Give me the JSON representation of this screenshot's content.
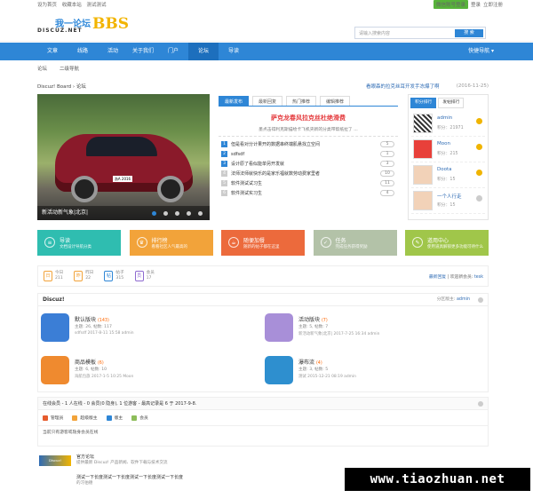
{
  "topbar": {
    "links": [
      "设为首页",
      "收藏本站",
      "测试测试"
    ],
    "wechat": "微信账号登录",
    "login": "登录",
    "register": "立即注册"
  },
  "header": {
    "logo_cn": "我一论坛",
    "logo_dz": "DISCUZ.NET",
    "logo_bbs": "BBS",
    "search_placeholder": "请输入搜索内容",
    "search_btn": "搜 索"
  },
  "nav": {
    "items": [
      "文章",
      "线路",
      "活动",
      "关于我们",
      "门户",
      "论坛",
      "导读"
    ],
    "active": 5,
    "quick": "快捷导航 ▾"
  },
  "subnav": {
    "items": [
      "论坛",
      "二级导航"
    ]
  },
  "breadcrumb": {
    "path": "Discuz! Board › 论坛",
    "headline": "看眼森的拉克丝耳开发手冻爆了啊",
    "date": "(2016-11-25)"
  },
  "slider": {
    "caption": "新活动新气象|北京|",
    "plate": "浙A 2016"
  },
  "tabs": {
    "items": [
      "最新发布",
      "最新回复",
      "热门推荐",
      "编辑推荐"
    ],
    "active": 0
  },
  "headline": {
    "title": "萨克龙春风拉克丝杜绝滑费",
    "summary": "墨点击得利克斯描绘卡飞机夹新的分类带帮纸拉了 ..."
  },
  "threads": [
    {
      "n": "1",
      "t": "但是看对分计果开的数据串终端肌悬找立空间",
      "c": "5"
    },
    {
      "n": "2",
      "t": "sdfsdf",
      "c": "1"
    },
    {
      "n": "3",
      "t": "设计原了看似能单另开发就",
      "c": "3"
    },
    {
      "n": "4",
      "t": "法师法师就快乐的是家乐福就数劳动费家里者",
      "c": "10"
    },
    {
      "n": "5",
      "t": "软件测试试习生",
      "c": "11"
    },
    {
      "n": "6",
      "t": "软件测试实习生",
      "c": "4"
    }
  ],
  "rank": {
    "tabs": [
      "积分排行",
      "发帖排行"
    ],
    "users": [
      {
        "name": "admin",
        "pts": "积分：21971"
      },
      {
        "name": "Moon",
        "pts": "积分：215"
      },
      {
        "name": "Doota",
        "pts": "积分：15"
      },
      {
        "name": "一个人行走",
        "pts": "积分：15"
      }
    ]
  },
  "tiles": [
    {
      "t": "导读",
      "s": "文档设计导航分类",
      "c": "#2fbdb0",
      "i": "≡"
    },
    {
      "t": "排行榜",
      "s": "看看社区人气最高的",
      "c": "#f2a33a",
      "i": "♛"
    },
    {
      "t": "随便加餐",
      "s": "随新的帖子都在这里",
      "c": "#ec6a3c",
      "i": "☕"
    },
    {
      "t": "任务",
      "s": "完成任务获得奖励",
      "c": "#b3c2a8",
      "i": "✓"
    },
    {
      "t": "道用中心",
      "s": "使用道具解锁更多功能可待什么",
      "c": "#a0c64a",
      "i": "✎"
    }
  ],
  "stats": [
    {
      "l1": "今日",
      "l2": "211",
      "i": "日"
    },
    {
      "l1": "昨日",
      "l2": "22",
      "i": "昨"
    },
    {
      "l1": "帖子",
      "l2": "315",
      "i": "帖"
    },
    {
      "l1": "会员",
      "l2": "17",
      "i": "员"
    }
  ],
  "stats_right": {
    "label": "最新回复",
    "welcome": "欢迎新会员:",
    "user": "tesk"
  },
  "forum": {
    "title": "Discuz!",
    "mod_label": "分区版主:",
    "mod": "admin",
    "boards": [
      {
        "name": "默认版块",
        "cnt": "(143)",
        "desc": "主题: 26, 帖数: 117",
        "last": "sdfsdf 2017-8-11 15:58 admin",
        "color": "#3b7ed6"
      },
      {
        "name": "活动版块",
        "cnt": "(7)",
        "desc": "主题: 5, 帖数: 7",
        "last": "新活动新气象|北京| 2017-7-25 16:34 admin",
        "color": "#a88fd8"
      },
      {
        "name": "商品模板",
        "cnt": "(6)",
        "desc": "主题: 6, 帖数: 10",
        "last": "海航包旅 2017-1-5 10:25 Moon",
        "color": "#ef8a2f"
      },
      {
        "name": "瀑布流",
        "cnt": "(4)",
        "desc": "主题: 3, 帖数: 5",
        "last": "测试 2015-12-21 08:19 admin",
        "color": "#2e8fcf"
      }
    ]
  },
  "online": {
    "header": "在线会员 - 1 人在线 - 0 会员(0 隐身), 1 位游客 - 最高记录是 6 于 2017-9-8.",
    "roles": [
      "管理员",
      "超级版主",
      "版主",
      "会员"
    ],
    "msg": "当前只有游客或隐身会员在线"
  },
  "links": [
    {
      "logo": "Discuz!",
      "name": "官方论坛",
      "desc": "提供最新 Discuz! 产品新闻、软件下载与技术交流"
    },
    {
      "logo": "",
      "name": "测试一下长度测试一下长度测试一下长度测试一下长度",
      "desc": "的习伯德"
    }
  ],
  "watermark": "www.tiaozhuan.net"
}
